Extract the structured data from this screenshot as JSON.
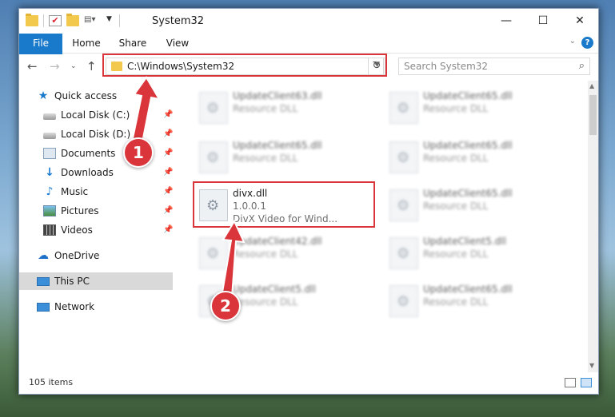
{
  "window": {
    "title": "System32",
    "minimize": "—",
    "maximize": "☐",
    "close": "✕"
  },
  "ribbon": {
    "tabs": [
      "File",
      "Home",
      "Share",
      "View"
    ]
  },
  "address": {
    "path": "C:\\Windows\\System32",
    "search_placeholder": "Search System32"
  },
  "sidebar": {
    "items": [
      {
        "label": "Quick access",
        "icon": "star-icon"
      },
      {
        "label": "Local Disk (C:)",
        "icon": "disk-icon"
      },
      {
        "label": "Local Disk (D:)",
        "icon": "disk-icon"
      },
      {
        "label": "Documents",
        "icon": "documents-icon"
      },
      {
        "label": "Downloads",
        "icon": "download-icon"
      },
      {
        "label": "Music",
        "icon": "music-icon"
      },
      {
        "label": "Pictures",
        "icon": "pictures-icon"
      },
      {
        "label": "Videos",
        "icon": "videos-icon"
      },
      {
        "label": "OneDrive",
        "icon": "cloud-icon"
      },
      {
        "label": "This PC",
        "icon": "computer-icon"
      },
      {
        "label": "Network",
        "icon": "network-icon"
      }
    ],
    "selected": "This PC"
  },
  "files": [
    {
      "name": "UpdateClient63.dll",
      "desc": "Resource DLL"
    },
    {
      "name": "UpdateClient65.dll",
      "desc": "Resource DLL"
    },
    {
      "name": "UpdateClient65.dll",
      "desc": "Resource DLL"
    },
    {
      "name": "UpdateClient65.dll",
      "desc": "Resource DLL"
    },
    {
      "name": "divx.dll",
      "desc": "1.0.0.1",
      "desc2": "DivX Video for Wind..."
    },
    {
      "name": "UpdateClient65.dll",
      "desc": "Resource DLL"
    },
    {
      "name": "UpdateClient42.dll",
      "desc": "Resource DLL"
    },
    {
      "name": "UpdateClient5.dll",
      "desc": "Resource DLL"
    },
    {
      "name": "UpdateClient5.dll",
      "desc": "Resource DLL"
    },
    {
      "name": "UpdateClient65.dll",
      "desc": "Resource DLL"
    }
  ],
  "status": {
    "count": "105 items"
  },
  "annotations": {
    "step1": "1",
    "step2": "2",
    "color": "#d9353b"
  }
}
